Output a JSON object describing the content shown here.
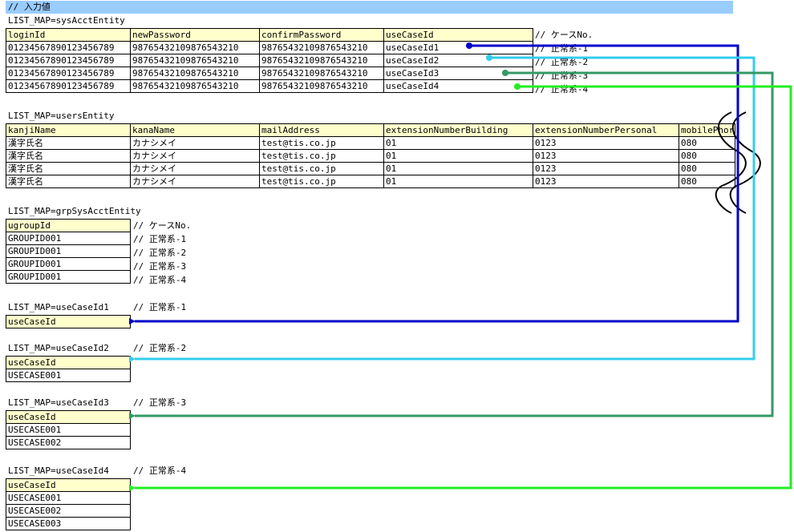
{
  "header": {
    "title": "// 入力値"
  },
  "sysAcct": {
    "label": "LIST_MAP=sysAcctEntity",
    "columns": [
      "loginId",
      "newPassword",
      "confirmPassword",
      "useCaseId"
    ],
    "case_header": "// ケースNo.",
    "rows": [
      {
        "cells": [
          "01234567890123456789",
          "98765432109876543210",
          "98765432109876543210",
          "useCaseId1"
        ],
        "comment": "// 正常系-1"
      },
      {
        "cells": [
          "01234567890123456789",
          "98765432109876543210",
          "98765432109876543210",
          "useCaseId2"
        ],
        "comment": "// 正常系-2"
      },
      {
        "cells": [
          "01234567890123456789",
          "98765432109876543210",
          "98765432109876543210",
          "useCaseId3"
        ],
        "comment": "// 正常系-3"
      },
      {
        "cells": [
          "01234567890123456789",
          "98765432109876543210",
          "98765432109876543210",
          "useCaseId4"
        ],
        "comment": "// 正常系-4"
      }
    ]
  },
  "users": {
    "label": "LIST_MAP=usersEntity",
    "columns": [
      "kanjiName",
      "kanaName",
      "mailAddress",
      "extensionNumberBuilding",
      "extensionNumberPersonal",
      "mobilePhor"
    ],
    "rows": [
      [
        "漢字氏名",
        "カナシメイ",
        "test@tis.co.jp",
        "01",
        "0123",
        "080"
      ],
      [
        "漢字氏名",
        "カナシメイ",
        "test@tis.co.jp",
        "01",
        "0123",
        "080"
      ],
      [
        "漢字氏名",
        "カナシメイ",
        "test@tis.co.jp",
        "01",
        "0123",
        "080"
      ],
      [
        "漢字氏名",
        "カナシメイ",
        "test@tis.co.jp",
        "01",
        "0123",
        "080"
      ]
    ]
  },
  "grp": {
    "label": "LIST_MAP=grpSysAcctEntity",
    "column": "ugroupId",
    "case_header": "// ケースNo.",
    "rows": [
      {
        "value": "GROUPID001",
        "comment": "// 正常系-1"
      },
      {
        "value": "GROUPID001",
        "comment": "// 正常系-2"
      },
      {
        "value": "GROUPID001",
        "comment": "// 正常系-3"
      },
      {
        "value": "GROUPID001",
        "comment": "// 正常系-4"
      }
    ]
  },
  "useCases": [
    {
      "label": "LIST_MAP=useCaseId1",
      "comment": "// 正常系-1",
      "column": "useCaseId",
      "values": []
    },
    {
      "label": "LIST_MAP=useCaseId2",
      "comment": "// 正常系-2",
      "column": "useCaseId",
      "values": [
        "USECASE001"
      ]
    },
    {
      "label": "LIST_MAP=useCaseId3",
      "comment": "// 正常系-3",
      "column": "useCaseId",
      "values": [
        "USECASE001",
        "USECASE002"
      ]
    },
    {
      "label": "LIST_MAP=useCaseId4",
      "comment": "// 正常系-4",
      "column": "useCaseId",
      "values": [
        "USECASE001",
        "USECASE002",
        "USECASE003"
      ]
    }
  ],
  "colors": {
    "header_bg": "#99ccff",
    "cell_header_bg": "#ffffcc",
    "arrow1": "#0000cc",
    "arrow2": "#33ccee",
    "arrow3": "#339966",
    "arrow4": "#22ee22"
  }
}
